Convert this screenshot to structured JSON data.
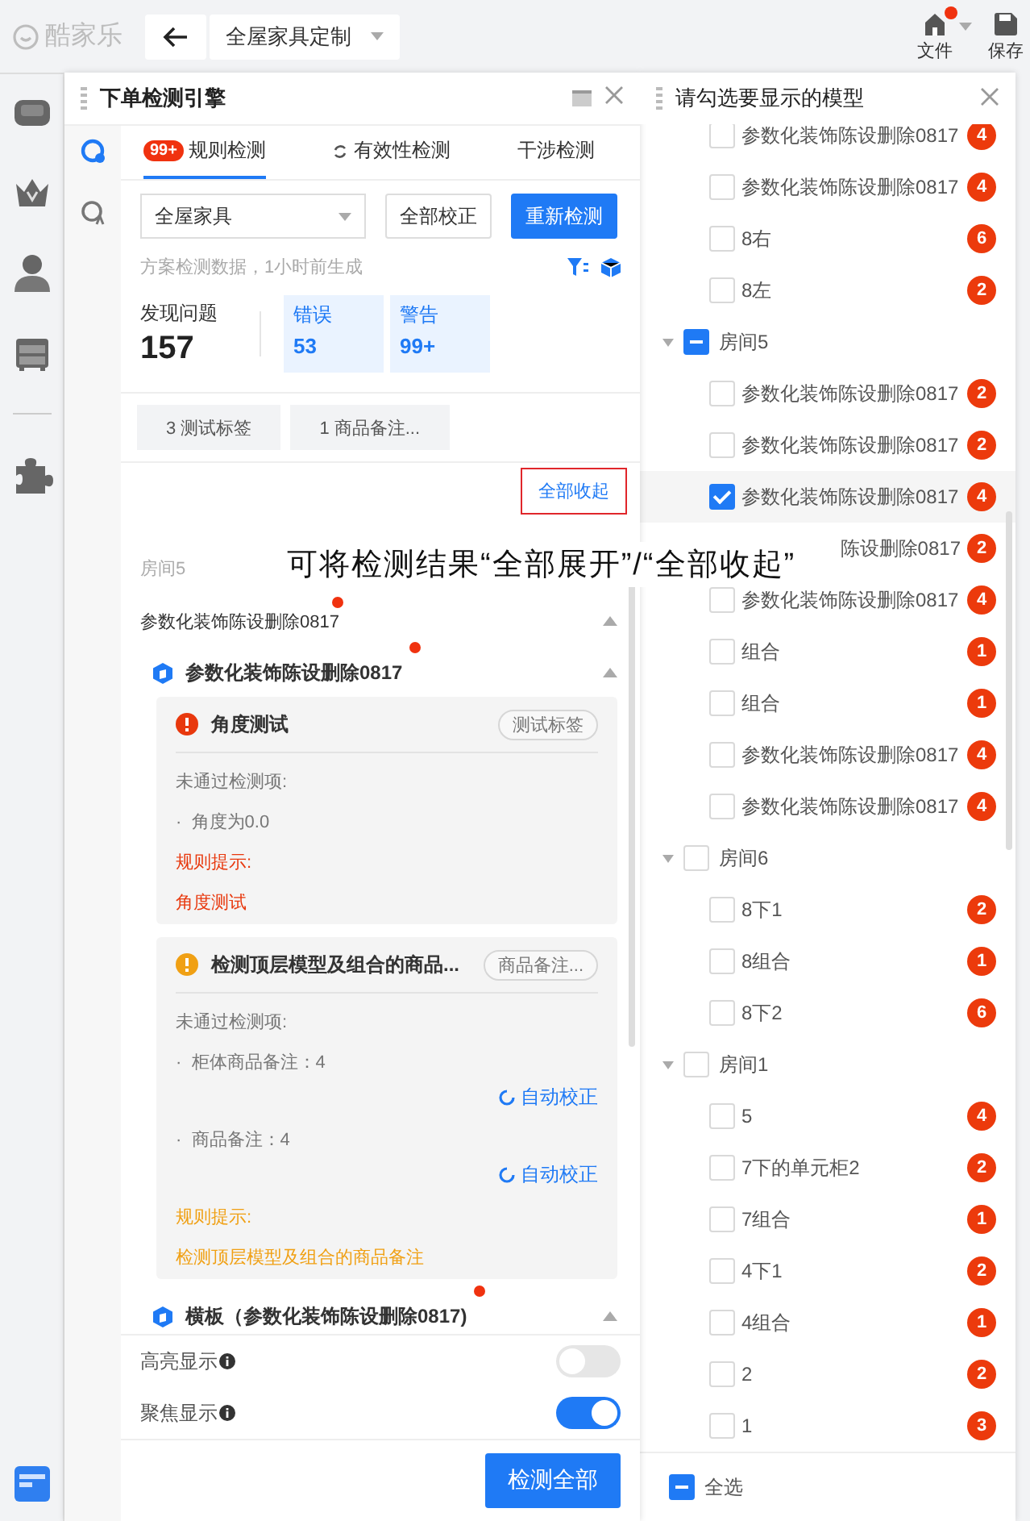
{
  "topbar": {
    "logo": "酷家乐",
    "scheme": "全屋家具定制",
    "file": "文件",
    "file_marked": true,
    "save": "保存"
  },
  "panel": {
    "title": "下单检测引擎",
    "tabs": [
      {
        "label": "规则检测",
        "badge": "99+",
        "selected": true
      },
      {
        "label": "有效性检测",
        "selected": false
      },
      {
        "label": "干涉检测",
        "selected": false
      }
    ],
    "scope": "全屋家具",
    "fix_all": "全部校正",
    "recheck": "重新检测",
    "info": "方案检测数据，1小时前生成",
    "stats": {
      "label": "发现问题",
      "total": "157",
      "errors_label": "错误",
      "errors": "53",
      "warnings_label": "警告",
      "warnings": "99+"
    },
    "tags": [
      "3 测试标签",
      "1 商品备注..."
    ],
    "collapse_all": "全部收起",
    "room": "房间5",
    "groups": [
      {
        "title": "参数化装饰陈设删除0817",
        "marked": true,
        "expanded": true,
        "items": [
          {
            "title": "参数化装饰陈设删除0817",
            "marked": true,
            "expanded": true,
            "issues": [
              {
                "kind": "error",
                "title": "角度测试",
                "tag": "测试标签",
                "failed_label": "未通过检测项:",
                "checks": [
                  {
                    "text": "·  角度为0.0"
                  }
                ],
                "hint_label": "规则提示:",
                "hint": "角度测试"
              },
              {
                "kind": "warning",
                "title": "检测顶层模型及组合的商品...",
                "tag": "商品备注...",
                "failed_label": "未通过检测项:",
                "checks": [
                  {
                    "text": "·  柜体商品备注：4",
                    "fix": "自动校正"
                  },
                  {
                    "text": "·  商品备注：4",
                    "fix": "自动校正"
                  }
                ],
                "hint_label": "规则提示:",
                "hint": "检测顶层模型及组合的商品备注"
              }
            ]
          },
          {
            "title": "横板（参数化装饰陈设删除0817)",
            "marked": true,
            "expanded": true
          }
        ]
      }
    ],
    "toggles": [
      {
        "label": "高亮显示",
        "on": false
      },
      {
        "label": "聚焦显示",
        "on": true
      }
    ],
    "check_all": "检测全部"
  },
  "annotation": "可将检测结果“全部展开”/“全部收起”",
  "models": {
    "title": "请勾选要显示的模型",
    "tree": [
      {
        "children": [
          {
            "label": "参数化装饰陈设删除0817",
            "count": "4",
            "checked": false
          },
          {
            "label": "参数化装饰陈设删除0817",
            "count": "4",
            "checked": false
          },
          {
            "label": "8右",
            "count": "6",
            "checked": false
          },
          {
            "label": "8左",
            "count": "2",
            "checked": false
          }
        ]
      },
      {
        "label": "房间5",
        "expanded": true,
        "checked": false,
        "indeterminate": true,
        "children": [
          {
            "label": "参数化装饰陈设删除0817",
            "count": "2",
            "checked": false
          },
          {
            "label": "参数化装饰陈设删除0817",
            "count": "2",
            "checked": false
          },
          {
            "label": "参数化装饰陈设删除0817",
            "count": "4",
            "checked": true
          },
          {
            "label": "陈设删除0817",
            "count": "2",
            "kind": "covered"
          },
          {
            "label": "参数化装饰陈设删除0817",
            "count": "4",
            "checked": false
          },
          {
            "label": "组合",
            "count": "1",
            "checked": false
          },
          {
            "label": "组合",
            "count": "1",
            "checked": false
          },
          {
            "label": "参数化装饰陈设删除0817",
            "count": "4",
            "checked": false
          },
          {
            "label": "参数化装饰陈设删除0817",
            "count": "4",
            "checked": false
          }
        ]
      },
      {
        "label": "房间6",
        "expanded": true,
        "checked": false,
        "indeterminate": false,
        "children": [
          {
            "label": "8下1",
            "count": "2",
            "checked": false
          },
          {
            "label": "8组合",
            "count": "1",
            "checked": false
          },
          {
            "label": "8下2",
            "count": "6",
            "checked": false
          }
        ]
      },
      {
        "label": "房间1",
        "expanded": true,
        "checked": false,
        "indeterminate": false,
        "children": [
          {
            "label": "5",
            "count": "4",
            "checked": false
          },
          {
            "label": "7下的单元柜2",
            "count": "2",
            "checked": false
          },
          {
            "label": "7组合",
            "count": "1",
            "checked": false
          },
          {
            "label": "4下1",
            "count": "2",
            "checked": false
          },
          {
            "label": "4组合",
            "count": "1",
            "checked": false
          },
          {
            "label": "2",
            "count": "2",
            "checked": false
          },
          {
            "label": "1",
            "count": "3",
            "checked": false
          }
        ]
      }
    ],
    "select_all": {
      "label": "全选",
      "checked": false,
      "indeterminate": true
    }
  }
}
